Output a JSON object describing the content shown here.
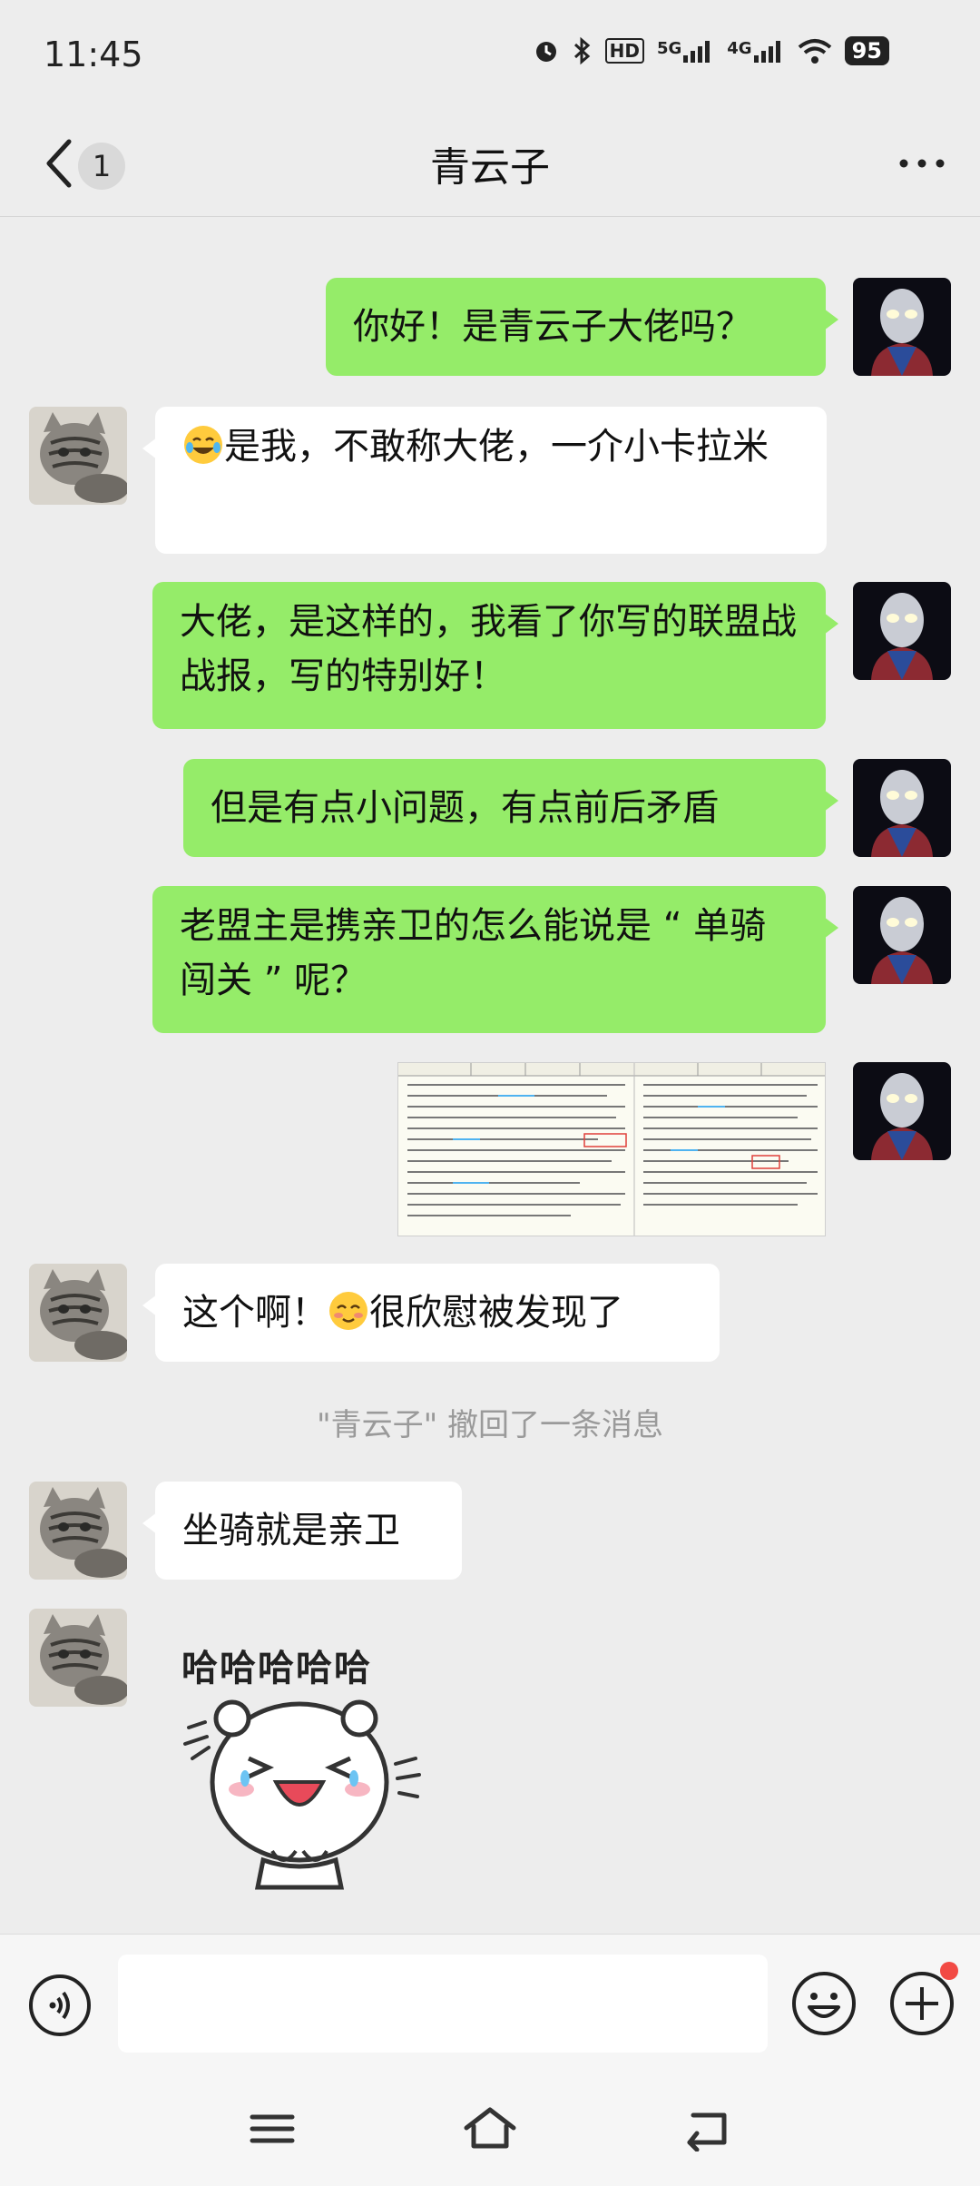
{
  "status_bar": {
    "time": "11:45",
    "network_hd": "HD",
    "network_5g": "5G",
    "network_4g": "4G",
    "battery": "95",
    "icons": [
      "alarm-icon",
      "bluetooth-icon",
      "hd-icon",
      "signal-5g-icon",
      "signal-4g-icon",
      "wifi-icon",
      "battery-icon"
    ]
  },
  "header": {
    "unread_count": "1",
    "title": "青云子"
  },
  "messages": [
    {
      "side": "me",
      "text": "你好！是青云子大佬吗？"
    },
    {
      "side": "them",
      "emoji": "tears-of-joy-emoji",
      "text": "是我，不敢称大佬，一介小卡拉米"
    },
    {
      "side": "me",
      "text": "大佬，是这样的，我看了你写的联盟战战报，写的特别好！"
    },
    {
      "side": "me",
      "text": "但是有点小问题，有点前后矛盾"
    },
    {
      "side": "me",
      "text": "老盟主是携亲卫的怎么能说是 “ 单骑闯关 ” 呢？"
    },
    {
      "side": "me",
      "type": "image",
      "text": ""
    },
    {
      "side": "them",
      "text_before": "这个啊！",
      "emoji": "blushing-emoji",
      "text_after": "很欣慰被发现了"
    },
    {
      "side": "system",
      "text": "\"青云子\" 撤回了一条消息"
    },
    {
      "side": "them",
      "text": "坐骑就是亲卫"
    },
    {
      "side": "them",
      "type": "sticker",
      "text": "哈哈哈哈哈"
    }
  ],
  "input_bar": {
    "placeholder": "",
    "icons": [
      "voice-icon",
      "sticker-icon",
      "plus-icon"
    ]
  },
  "nav_bar": {
    "icons": [
      "menu-icon",
      "home-icon",
      "back-icon"
    ]
  },
  "colors": {
    "my_bubble": "#95ec69",
    "their_bubble": "#ffffff",
    "background": "#ededed"
  }
}
